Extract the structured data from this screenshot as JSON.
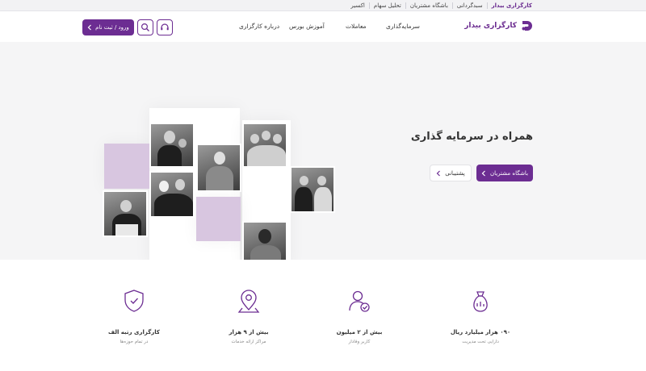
{
  "topbar": {
    "brand": "کارگزاری بیدار",
    "links": [
      "سبدگردانی",
      "باشگاه مشتریان",
      "تحلیل سهام",
      "اکسیر"
    ]
  },
  "header": {
    "logo_text": "کارگزاری بیدار",
    "nav": [
      "سرمایه‌گذاری",
      "معاملات",
      "آموزش بورس",
      "درباره کارگزاری"
    ],
    "login_label": "ورود / ثبت نام"
  },
  "hero": {
    "title": "همراه در سرمایه گذاری",
    "primary_button": "باشگاه مشتریان",
    "secondary_button": "پشتیبانی"
  },
  "stats": [
    {
      "icon": "money-bag-icon",
      "value": "۰۹۰ هزار میلیارد ریال",
      "label": "دارایی تحت مدیریت"
    },
    {
      "icon": "user-check-icon",
      "value": "بیش از ۲ میلیون",
      "label": "کاربر وفادار"
    },
    {
      "icon": "location-pin-icon",
      "value": "بیش از ۹ هزار",
      "label": "مراکز ارائه خدمات"
    },
    {
      "icon": "shield-check-icon",
      "value": "کارگزاری رتبه الف",
      "label": "در تمام حوزه‌ها"
    }
  ],
  "colors": {
    "brand": "#6c2d92",
    "lavender": "#d8c6e0"
  }
}
